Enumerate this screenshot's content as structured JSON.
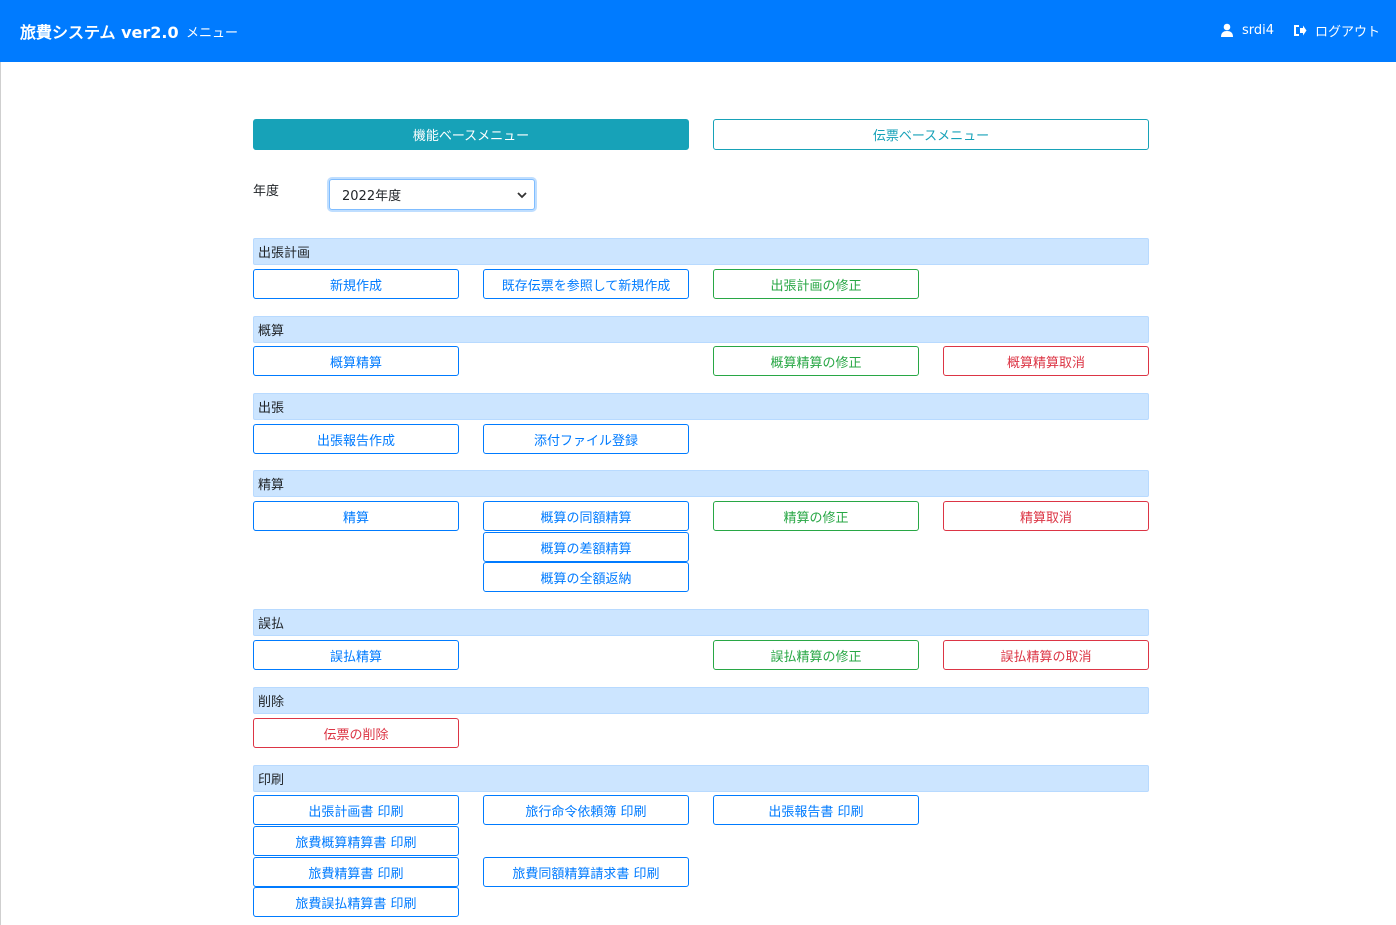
{
  "navbar": {
    "brand": "旅費システム ver2.0",
    "menu_link": "メニュー",
    "user_name": "srdi4",
    "user_icon": "user-icon",
    "logout_label": "ログアウト",
    "logout_icon": "sign-out-icon",
    "color": "#007bff"
  },
  "tabs": {
    "function_menu": "機能ベースメニュー",
    "voucher_menu": "伝票ベースメニュー"
  },
  "year": {
    "label": "年度",
    "selected": "2022年度"
  },
  "sections": {
    "plan": {
      "title": "出張計画",
      "new": "新規作成",
      "new_from_existing": "既存伝票を参照して新規作成",
      "modify": "出張計画の修正"
    },
    "estimate": {
      "title": "概算",
      "settle": "概算精算",
      "modify": "概算精算の修正",
      "cancel": "概算精算取消"
    },
    "trip": {
      "title": "出張",
      "report": "出張報告作成",
      "attach": "添付ファイル登録"
    },
    "settlement": {
      "title": "精算",
      "settle": "精算",
      "same_amount": "概算の同額精算",
      "difference": "概算の差額精算",
      "full_refund": "概算の全額返納",
      "modify": "精算の修正",
      "cancel": "精算取消"
    },
    "overpay": {
      "title": "誤払",
      "settle": "誤払精算",
      "modify": "誤払精算の修正",
      "cancel": "誤払精算の取消"
    },
    "delete": {
      "title": "削除",
      "delete_voucher": "伝票の削除"
    },
    "print": {
      "title": "印刷",
      "plan_print": "出張計画書 印刷",
      "order_print": "旅行命令依頼簿 印刷",
      "report_print": "出張報告書 印刷",
      "estimate_print": "旅費概算精算書 印刷",
      "settle_print": "旅費精算書 印刷",
      "same_amount_print": "旅費同額精算請求書 印刷",
      "overpay_print": "旅費誤払精算書 印刷"
    }
  },
  "colors": {
    "primary": "#007bff",
    "success": "#28a745",
    "danger": "#dc3545",
    "info": "#17a2b8",
    "section_bg": "#cce5ff"
  }
}
